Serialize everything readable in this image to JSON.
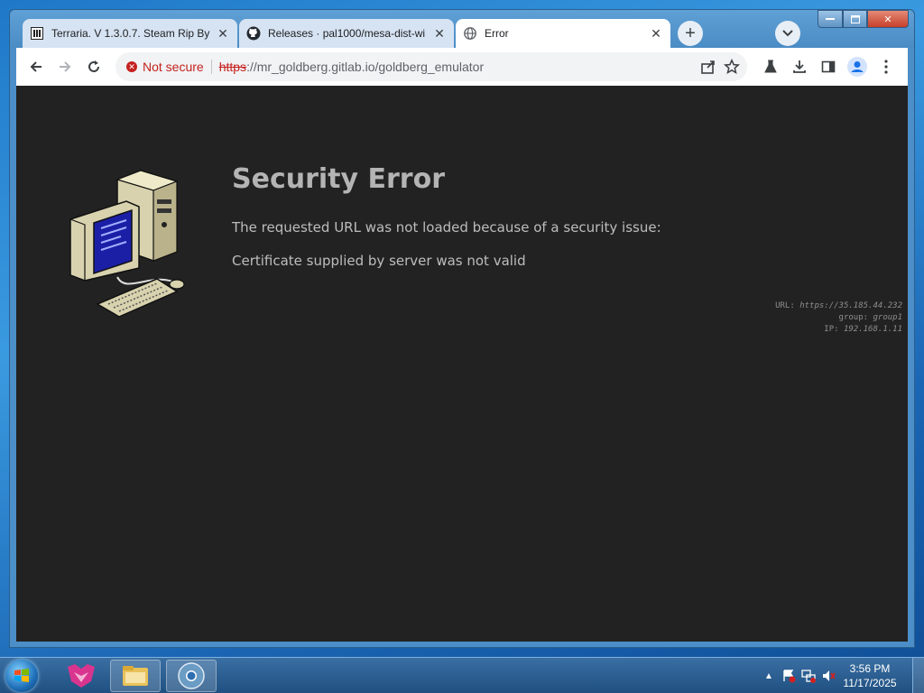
{
  "browser": {
    "tabs": [
      {
        "title": "Terraria. V 1.3.0.7. Steam Rip By",
        "favicon": "terraria-icon",
        "active": false
      },
      {
        "title": "Releases · pal1000/mesa-dist-wi",
        "favicon": "github-icon",
        "active": false
      },
      {
        "title": "Error",
        "favicon": "globe-icon",
        "active": true
      }
    ],
    "new_tab_label": "+",
    "security_label": "Not secure",
    "url_scheme": "https",
    "url_rest": "://mr_goldberg.gitlab.io/goldberg_emulator"
  },
  "page": {
    "title": "Security Error",
    "line1": "The requested URL was not loaded because of a security issue:",
    "line2": "Certificate supplied by server was not valid",
    "meta": {
      "url_label": "URL:",
      "url_value": "https://35.185.44.232",
      "group_label": "group:",
      "group_value": "group1",
      "ip_label": "IP:",
      "ip_value": "192.168.1.11"
    }
  },
  "taskbar": {
    "time": "3:56 PM",
    "date": "11/17/2025"
  }
}
